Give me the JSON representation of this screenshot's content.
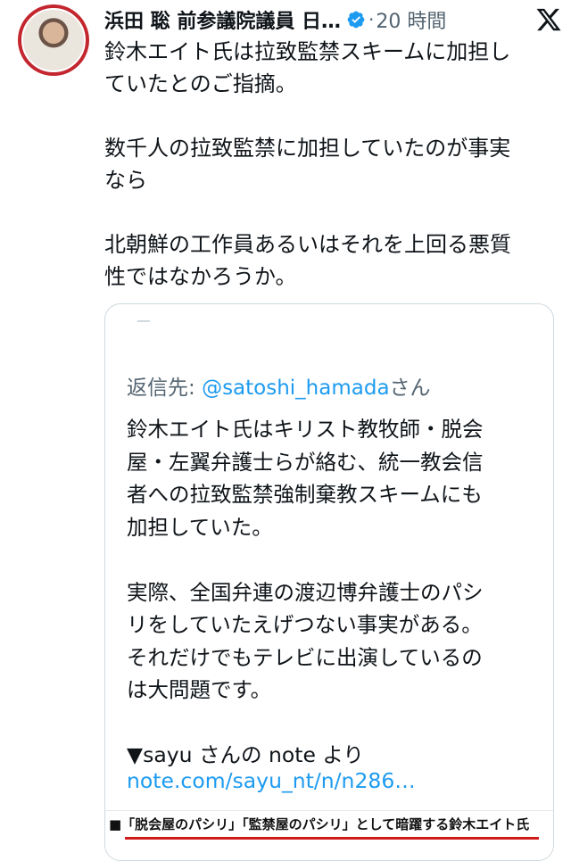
{
  "author": {
    "name": "浜田 聡 前参議院議員 日…",
    "verified_icon": "verified-badge-icon",
    "separator": "·",
    "time": "20 時間"
  },
  "platform_icon": "x-logo-icon",
  "tweet": {
    "text": "鈴木エイト氏は拉致監禁スキームに加担し\nていたとのご指摘。\n\n数千人の拉致監禁に加担していたのが事実\nなら\n\n北朝鮮の工作員あるいはそれを上回る悪質\n性ではなかろうか。"
  },
  "quote": {
    "reply_prefix": "返信先: ",
    "reply_mention": "@satoshi_hamada",
    "reply_suffix": "さん",
    "text": "鈴木エイト氏はキリスト教牧師・脱会\n屋・左翼弁護士らが絡む、統一教会信\n者への拉致監禁強制棄教スキームにも\n加担していた。\n\n実際、全国弁連の渡辺博弁護士のパシ\nリをしていたえげつない事実がある。\nそれだけでもテレビに出演しているの\nは大問題です。\n\n▼sayu さんの note より",
    "link": "note.com/sayu_nt/n/n286…",
    "image_caption": "■「脱会屋のパシリ」「監禁屋のパシリ」として暗躍する鈴木エイト氏"
  },
  "colors": {
    "text": "#0f1419",
    "secondary": "#536471",
    "link": "#1d9bf0",
    "avatar_ring": "#c4262e",
    "caption_underline": "#d11a1a"
  }
}
